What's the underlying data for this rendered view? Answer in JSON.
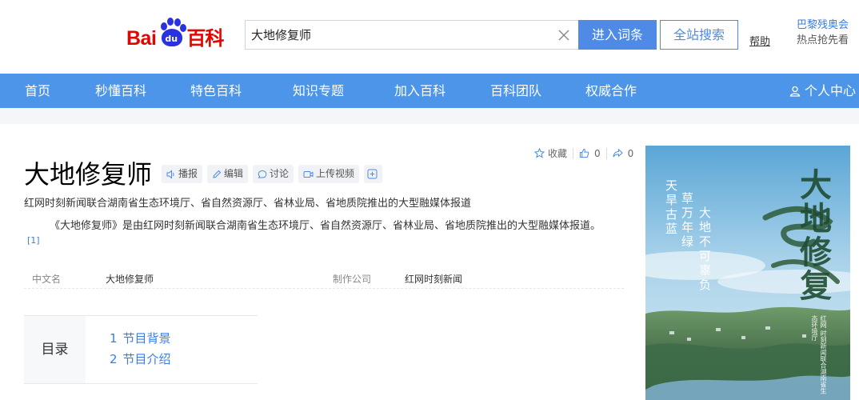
{
  "header": {
    "logo_left": "Bai",
    "logo_mid": "du",
    "logo_right": "百科",
    "search_value": "大地修复师",
    "enter_button": "进入词条",
    "all_search_button": "全站搜索",
    "help_link": "帮助",
    "hot_title": "巴黎残奥会",
    "hot_subtitle": "热点抢先看"
  },
  "nav": {
    "items": [
      "首页",
      "秒懂百科",
      "特色百科",
      "知识专题",
      "加入百科",
      "百科团队",
      "权威合作"
    ],
    "user": "个人中心"
  },
  "toptools": {
    "collect": "收藏",
    "like_count": "0",
    "share_count": "0"
  },
  "entry": {
    "title": "大地修复师",
    "tools": [
      "播报",
      "编辑",
      "讨论",
      "上传视频"
    ],
    "subtitle": "红网时刻新闻联合湖南省生态环境厅、省自然资源厅、省林业局、省地质院推出的大型融媒体报道",
    "summary": "《大地修复师》是由红网时刻新闻联合湖南省生态环境厅、省自然资源厅、省林业局、省地质院推出的大型融媒体报道。",
    "citation": "[1]"
  },
  "infobox": {
    "k1": "中文名",
    "v1": "大地修复师",
    "k2": "制作公司",
    "v2": "红网时刻新闻"
  },
  "toc": {
    "heading": "目录",
    "items": [
      {
        "num": "1",
        "label": "节目背景"
      },
      {
        "num": "2",
        "label": "节目介绍"
      }
    ]
  },
  "poster": {
    "brush_title": "大地修复",
    "line1": "天旱古蓝",
    "line2": "草万年绿",
    "line3": "大地不可辜负",
    "footer": "红网 时刻新闻联合湖南省生态环境厅"
  }
}
